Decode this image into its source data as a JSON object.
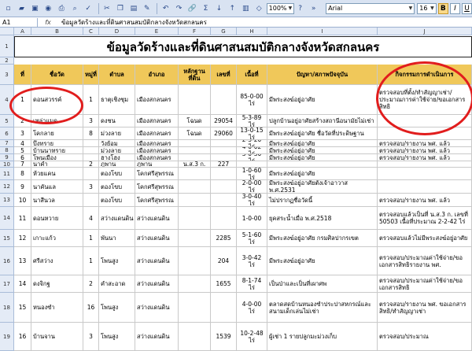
{
  "toolbar": {
    "font_name": "Arial",
    "font_size": "16",
    "bold": "B",
    "italic": "I",
    "underline": "U",
    "zoom": "100%"
  },
  "formula_bar": {
    "cell_ref": "A1",
    "fx": "fx",
    "content": "ข้อมูลวัดร้างและที่ดินศาสนสมบัติกลางจังหวัดสกลนคร"
  },
  "columns": [
    "A",
    "B",
    "C",
    "D",
    "E",
    "F",
    "G",
    "H",
    "I",
    "J"
  ],
  "sheet_title": "ข้อมูลวัดร้างและที่ดินศาสนสมบัติกลางจังหวัดสกลนคร",
  "header": [
    "ที่",
    "ชื่อวัด",
    "หมู่ที่",
    "ตำบล",
    "อำเภอ",
    "หลักฐานที่ดิน",
    "เลขที่",
    "เนื้อที่",
    "ปัญหา/สภาพปัจจุบัน",
    "กิจกรรมการดำเนินการ"
  ],
  "rows": [
    {
      "rn": "4",
      "c": [
        "1",
        "ดอนสวรรค์",
        "1",
        "ธาตุเชิงชุม",
        "เมืองสกลนคร",
        "",
        "",
        "85-0-00 ไร่",
        "มีพระสงฆ์อยู่อาศัย",
        "ตรวจสอบที่ตั้ง/ทำสัญญาเช่า/ประมาณการค่าใช้จ่าย/ขอเอกสารสิทธิ"
      ]
    },
    {
      "rn": "5",
      "c": [
        "2",
        "เหล่าแมด",
        "3",
        "ดงชน",
        "เมืองสกลนคร",
        "โฉนด",
        "29054",
        "5-3-89 ไร่",
        "ปลูกบ้านอยู่อาศัยสร้างสถานีอนามัยไม่เช่า",
        ""
      ]
    },
    {
      "rn": "6",
      "c": [
        "3",
        "โคกลาย",
        "8",
        "ม่วงลาย",
        "เมืองสกลนคร",
        "โฉนด",
        "29060",
        "13-0-15 ไร่",
        "มีพระสงฆ์อยู่อาศัย ชื่อวัดที่ประดิษฐาน",
        ""
      ]
    },
    {
      "rn": "7",
      "c": [
        "4",
        "บึงทราย",
        "",
        "วังย้อม",
        "เมืองสกลนคร",
        "",
        "",
        "2-3-20 ไร่",
        "มีพระสงฆ์อยู่อาศัย",
        "ตรวจสอบ/รายงาน พศ. แล้ว"
      ]
    },
    {
      "rn": "8",
      "c": [
        "5",
        "บ้านนาทราย",
        "",
        "ม่วงลาย",
        "เมืองสกลนคร",
        "",
        "",
        "4-0-02 ไร่",
        "มีพระสงฆ์อยู่อาศัย",
        "ตรวจสอบ/รายงาน พศ. แล้ว"
      ]
    },
    {
      "rn": "9",
      "c": [
        "6",
        "โพนเมือง",
        "",
        "ฮางโฮง",
        "เมืองสกลนคร",
        "",
        "",
        "3-0-30 ไร่",
        "มีพระสงฆ์อยู่อาศัย",
        "ตรวจสอบ/รายงาน พศ. แล้ว"
      ]
    },
    {
      "rn": "10",
      "c": [
        "7",
        "นาคำ",
        "2",
        "ภูพาน",
        "ภูพาน",
        "น.ส.3 ก.",
        "227",
        "",
        "",
        "",
        ""
      ]
    },
    {
      "rn": "11",
      "c": [
        "8",
        "ห้วยแคน",
        "",
        "ตองโขบ",
        "โคกศรีสุพรรณ",
        "",
        "",
        "1-0-60 ไร่",
        "มีพระสงฆ์อยู่อาศัย",
        ""
      ]
    },
    {
      "rn": "12",
      "c": [
        "9",
        "นาคันแล",
        "3",
        "ตองโขบ",
        "โคกศรีสุพรรณ",
        "",
        "",
        "2-0-00 ไร่",
        "มีพระสงฆ์อยู่อาศัยตั้งเจ้าอาวาส พ.ศ.2531",
        ""
      ]
    },
    {
      "rn": "13",
      "c": [
        "10",
        "นาสีนวล",
        "",
        "ตองโขบ",
        "โคกศรีสุพรรณ",
        "",
        "",
        "3-0-40 ไร่",
        "ไม่ปรากฏชื่อวัดนี้",
        "ตรวจสอบ/รายงาน พศ. แล้ว"
      ]
    },
    {
      "rn": "14",
      "c": [
        "11",
        "ดอนหวาย",
        "4",
        "สว่างแดนดิน",
        "สว่างแดนดิน",
        "",
        "",
        "1-0-00",
        "ยุคสระน้ำเมื่อ พ.ศ.2518",
        "ตรวจสอบแล้วเป็นที่ น.ส.3 ก. เลขที่ 50503 เนื้อที่ประมาณ 2-2-42 ไร่"
      ]
    },
    {
      "rn": "15",
      "c": [
        "12",
        "เกาะแก้ว",
        "1",
        "พันนา",
        "สว่างแดนดิน",
        "",
        "2285",
        "5-1-60 ไร่",
        "มีพระสงฆ์อยู่อาศัย กรมศิลปากรเขต",
        "ตรวจสอบแล้วไม่มีพระสงฆ์อยู่อาศัย"
      ]
    },
    {
      "rn": "16",
      "c": [
        "13",
        "ศรีสว่าง",
        "1",
        "โพนสูง",
        "สว่างแดนดิน",
        "",
        "204",
        "3-0-42 ไร่",
        "มีพระสงฆ์อยู่อาศัย",
        "ตรวจสอบ/ประมาณค่าใช้จ่าย/ขอเอกสารสิทธิรายงาน พศ."
      ]
    },
    {
      "rn": "17",
      "c": [
        "14",
        "ดงจิกฐ",
        "2",
        "คำสะอาด",
        "สว่างแดนดิน",
        "",
        "1655",
        "8-1-74 ไร่",
        "เป็นป่าและเป็นที่เผาศพ",
        "ตรวจสอบ/ประมาณค่าใช้จ่าย/ขอเอกสารสิทธิ"
      ]
    },
    {
      "rn": "18",
      "c": [
        "15",
        "หนองซำ",
        "16",
        "โพนสูง",
        "สว่างแดนดิน",
        "",
        "",
        "4-0-00 ไร่",
        "ตลาดสดบ้านหนองซำประปาสหกรณ์และสนามเด็กเล่นไม่เช่า",
        "ตรวจสอบ/รายงาน พศ. ขอเอกสารสิทธิ/ทำสัญญาเช่า"
      ]
    },
    {
      "rn": "19",
      "c": [
        "16",
        "บ้านจาน",
        "3",
        "โพนสูง",
        "สว่างแดนดิน",
        "",
        "1539",
        "10-2-48 ไร่",
        "ผู้เช่า 1 รายปลูกมะม่วงเก็บ",
        "ตรวจสอบ/ประมาณ"
      ]
    }
  ]
}
